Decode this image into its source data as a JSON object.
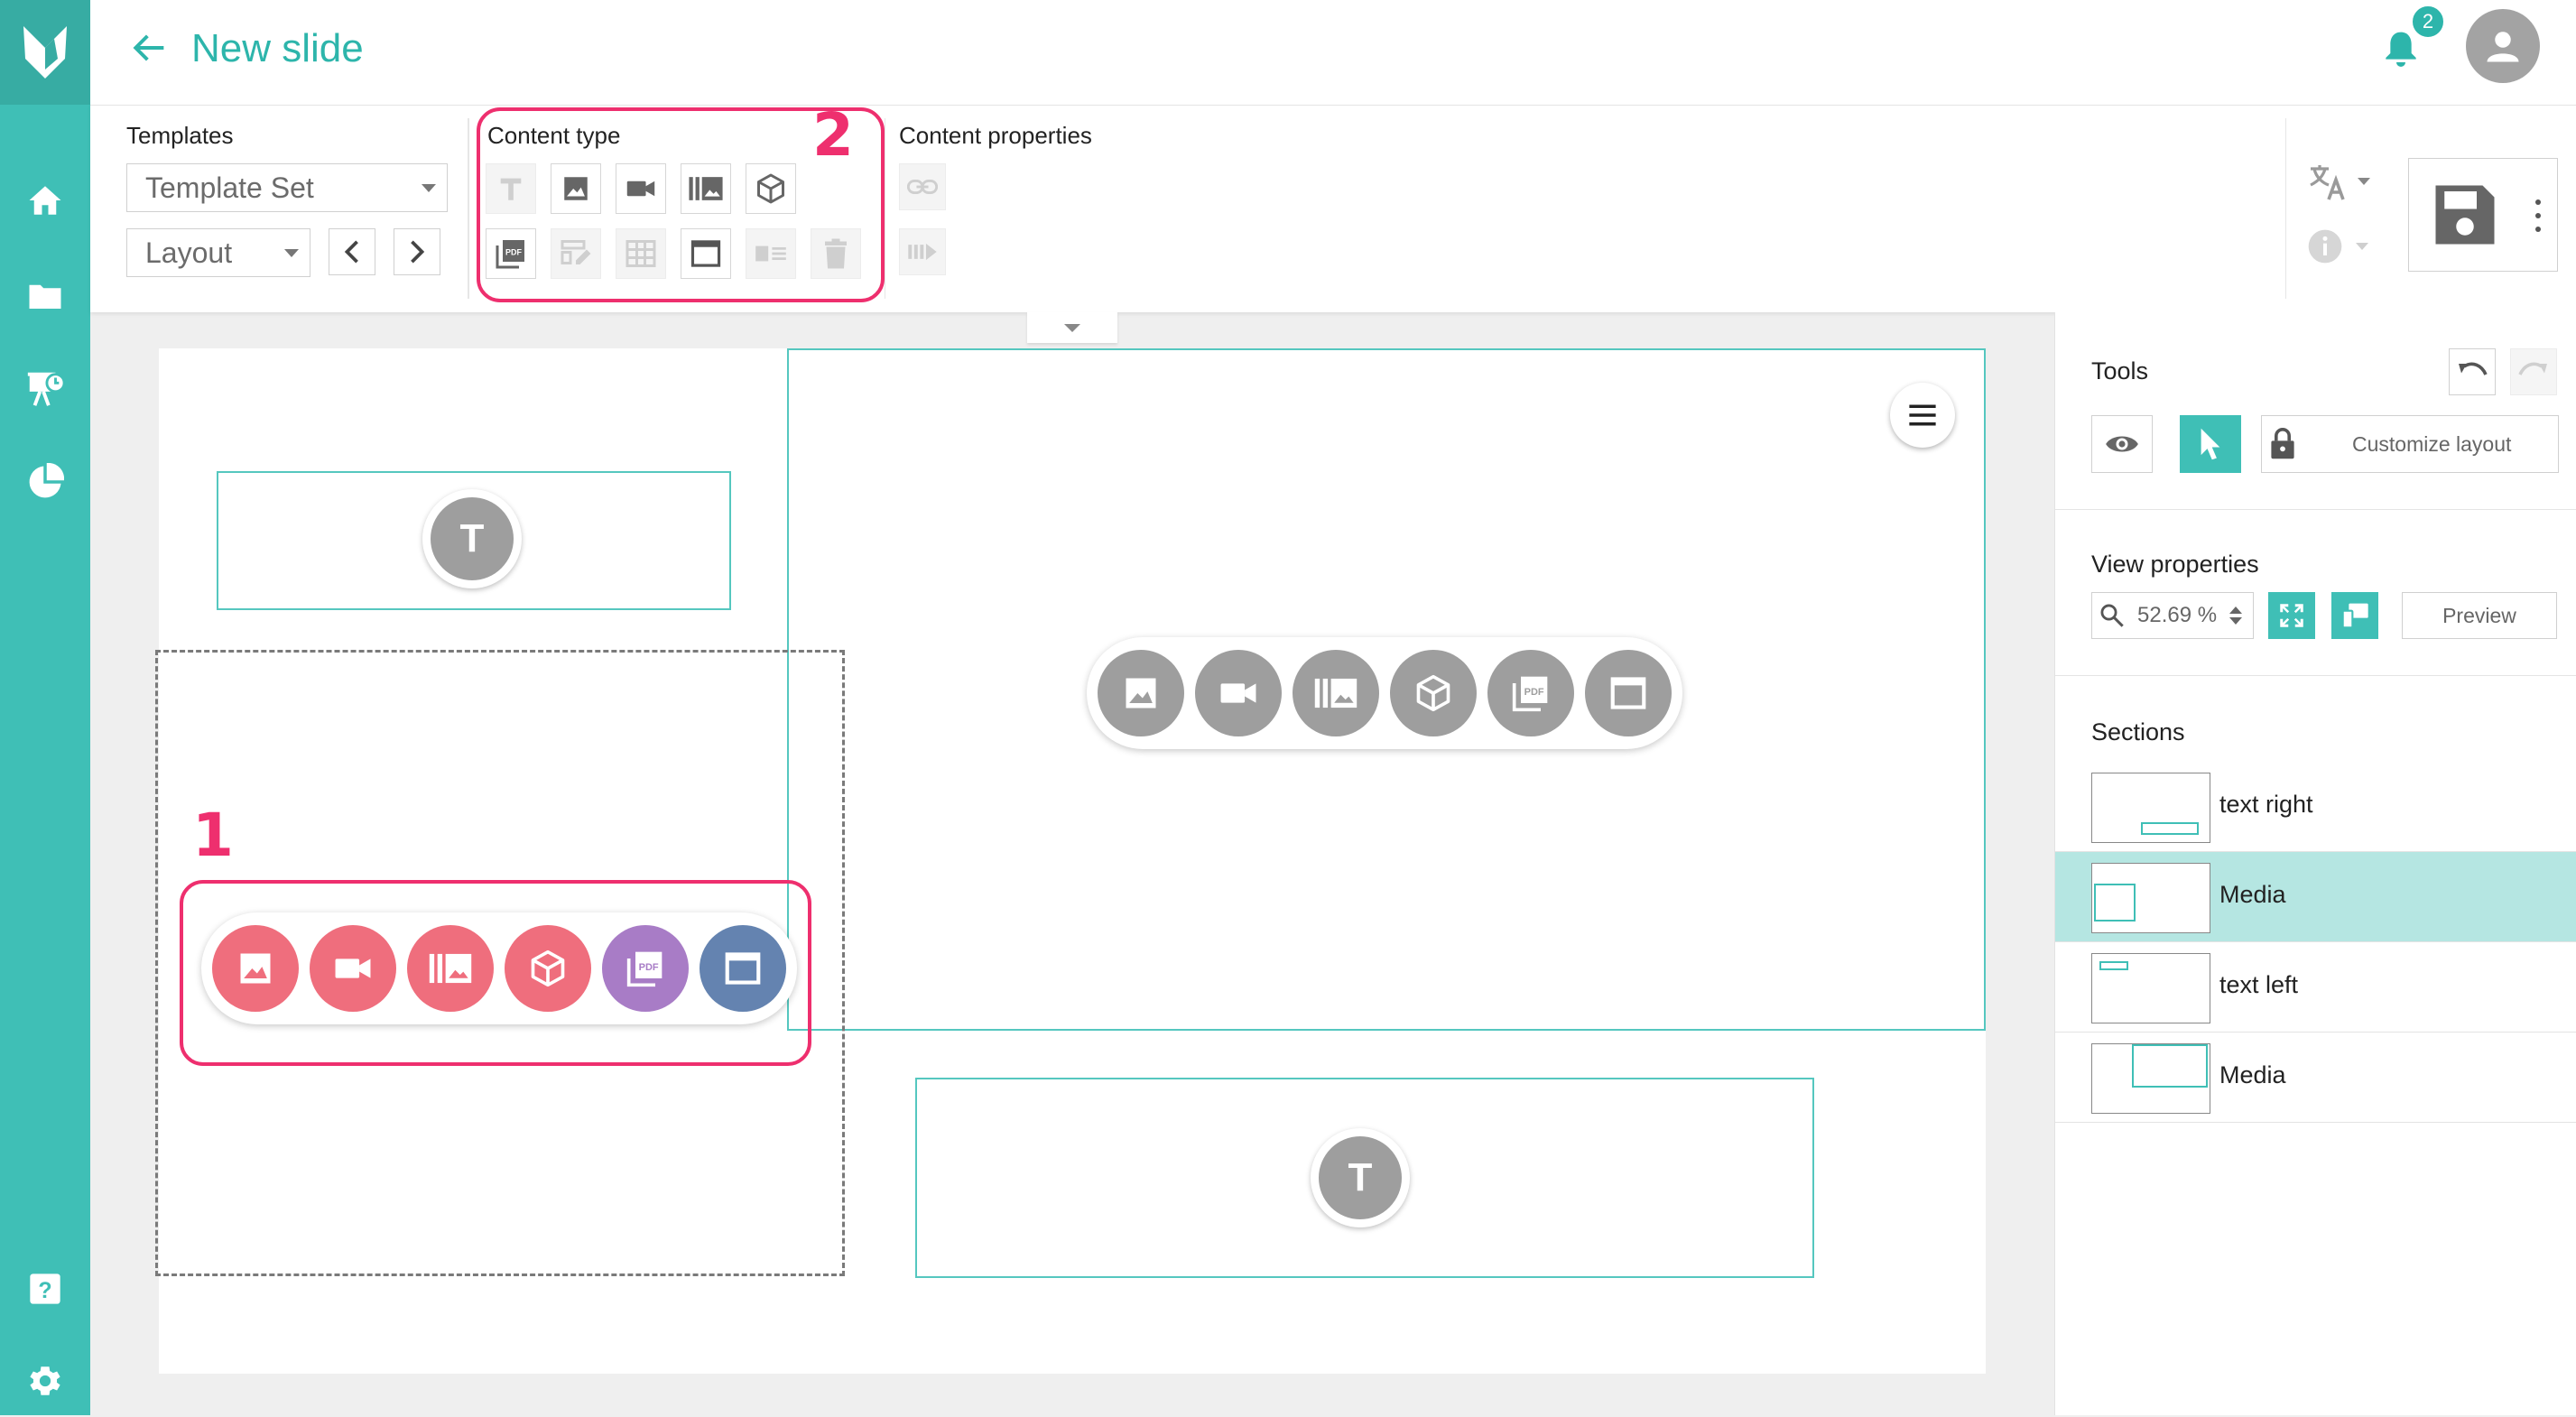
{
  "header": {
    "title": "New slide",
    "notification_count": "2"
  },
  "toolbar": {
    "templates": {
      "label": "Templates",
      "template_set": "Template Set",
      "layout": "Layout"
    },
    "content_type": {
      "label": "Content type",
      "annotation": "2"
    },
    "content_properties": {
      "label": "Content properties"
    }
  },
  "canvas": {
    "text_placeholder": "T",
    "annotation": "1",
    "media_colors": {
      "image": "#ef6e7d",
      "video": "#ef6e7d",
      "gallery": "#ef6e7d",
      "model": "#ef6e7d",
      "pdf": "#a87cc6",
      "frame": "#6483b0",
      "neutral": "#9e9e9e"
    }
  },
  "panel": {
    "tools": {
      "label": "Tools",
      "customize_layout": "Customize layout"
    },
    "view_properties": {
      "label": "View properties",
      "zoom": "52.69 %",
      "preview": "Preview"
    },
    "sections": {
      "label": "Sections",
      "items": [
        {
          "label": "text right",
          "active": false
        },
        {
          "label": "Media",
          "active": true
        },
        {
          "label": "text left",
          "active": false
        },
        {
          "label": "Media",
          "active": false
        }
      ]
    }
  },
  "colors": {
    "accent": "#3fbfb6",
    "annotation": "#ee2f6e"
  }
}
